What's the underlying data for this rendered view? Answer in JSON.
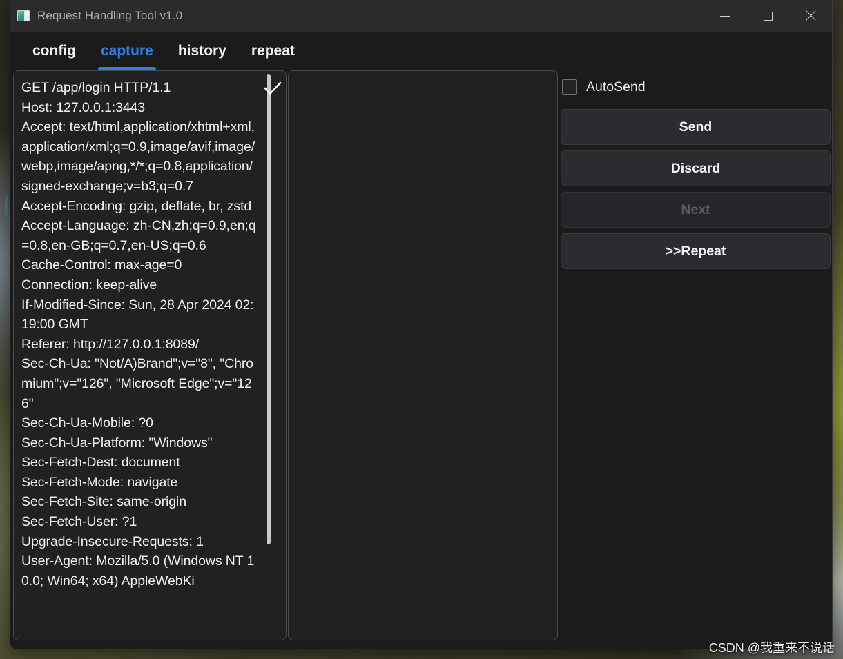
{
  "window": {
    "title": "Request Handling Tool v1.0",
    "icon": "app-window-icon",
    "controls": {
      "minimize": "minimize-icon",
      "maximize": "maximize-icon",
      "close": "close-icon"
    }
  },
  "tabs": [
    {
      "label": "config",
      "active": false
    },
    {
      "label": "capture",
      "active": true
    },
    {
      "label": "history",
      "active": false
    },
    {
      "label": "repeat",
      "active": false
    }
  ],
  "request_panel": {
    "check_icon": "checkmark-icon",
    "scroll_position": "top",
    "text": "GET /app/login HTTP/1.1\nHost: 127.0.0.1:3443\nAccept: text/html,application/xhtml+xml,application/xml;q=0.9,image/avif,image/webp,image/apng,*/*;q=0.8,application/signed-exchange;v=b3;q=0.7\nAccept-Encoding: gzip, deflate, br, zstd\nAccept-Language: zh-CN,zh;q=0.9,en;q=0.8,en-GB;q=0.7,en-US;q=0.6\nCache-Control: max-age=0\nConnection: keep-alive\nIf-Modified-Since: Sun, 28 Apr 2024 02:19:00 GMT\nReferer: http://127.0.0.1:8089/\nSec-Ch-Ua: \"Not/A)Brand\";v=\"8\", \"Chromium\";v=\"126\", \"Microsoft Edge\";v=\"126\"\nSec-Ch-Ua-Mobile: ?0\nSec-Ch-Ua-Platform: \"Windows\"\nSec-Fetch-Dest: document\nSec-Fetch-Mode: navigate\nSec-Fetch-Site: same-origin\nSec-Fetch-User: ?1\nUpgrade-Insecure-Requests: 1\nUser-Agent: Mozilla/5.0 (Windows NT 10.0; Win64; x64) AppleWebKi"
  },
  "response_panel": {
    "text": ""
  },
  "controls": {
    "autosend_label": "AutoSend",
    "autosend_checked": false,
    "buttons": [
      {
        "label": "Send",
        "disabled": false
      },
      {
        "label": "Discard",
        "disabled": false
      },
      {
        "label": "Next",
        "disabled": true
      },
      {
        "label": ">>Repeat",
        "disabled": false
      }
    ]
  },
  "watermark": "CSDN @我重来不说话",
  "colors": {
    "accent": "#2f7fe8",
    "window_bg": "#232323",
    "panel_bg": "#212124",
    "titlebar_bg": "#2b2b2b",
    "tabbar_bg": "#1b1b1b",
    "button_bg": "#2b2b30",
    "text": "#f0f0f0",
    "text_muted": "#aeaeae",
    "text_disabled": "#5b5b5f"
  }
}
